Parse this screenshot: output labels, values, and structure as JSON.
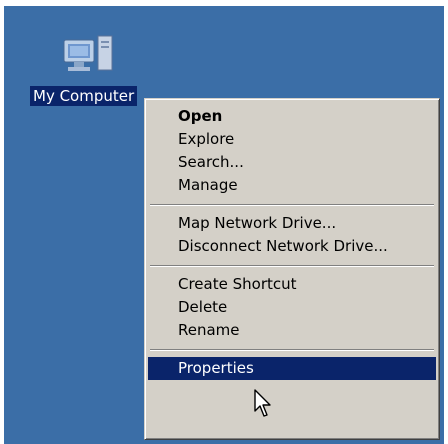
{
  "desktop": {
    "background_color": "#3b6ea7",
    "icon": {
      "name": "my-computer-icon",
      "label": "My Computer"
    }
  },
  "context_menu": {
    "selected_color": "#0a246a",
    "groups": [
      [
        {
          "label": "Open",
          "bold": true
        },
        {
          "label": "Explore"
        },
        {
          "label": "Search..."
        },
        {
          "label": "Manage"
        }
      ],
      [
        {
          "label": "Map Network Drive..."
        },
        {
          "label": "Disconnect Network Drive..."
        }
      ],
      [
        {
          "label": "Create Shortcut"
        },
        {
          "label": "Delete"
        },
        {
          "label": "Rename"
        }
      ],
      [
        {
          "label": "Properties",
          "selected": true
        }
      ]
    ]
  },
  "cursor": {
    "name": "arrow-cursor-icon"
  }
}
